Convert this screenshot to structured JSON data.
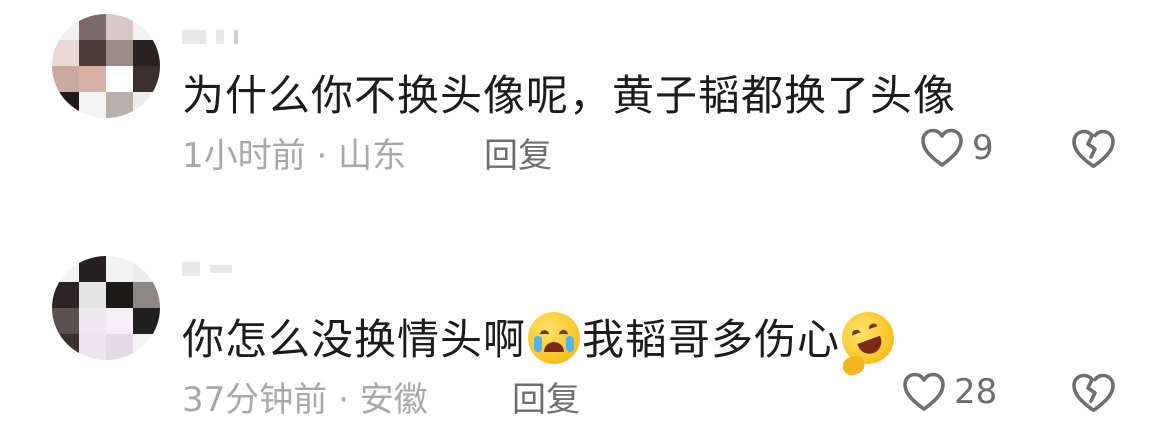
{
  "comments": [
    {
      "text": "为什么你不换头像呢，黄子韬都换了头像",
      "time": "1小时前",
      "location": "山东",
      "reply_label": "回复",
      "likes": "9"
    },
    {
      "text_part1": "你怎么没换情头啊",
      "text_part2": "我韬哥多伤心",
      "emoji_1": "loudly-crying-face",
      "emoji_2": "rolling-on-the-floor-laughing",
      "time": "37分钟前",
      "location": "安徽",
      "reply_label": "回复",
      "likes": "28"
    }
  ],
  "separator": " · ",
  "colors": {
    "text": "#1c1c1c",
    "meta": "#a8a8a8",
    "icon": "#6e6e6e"
  }
}
